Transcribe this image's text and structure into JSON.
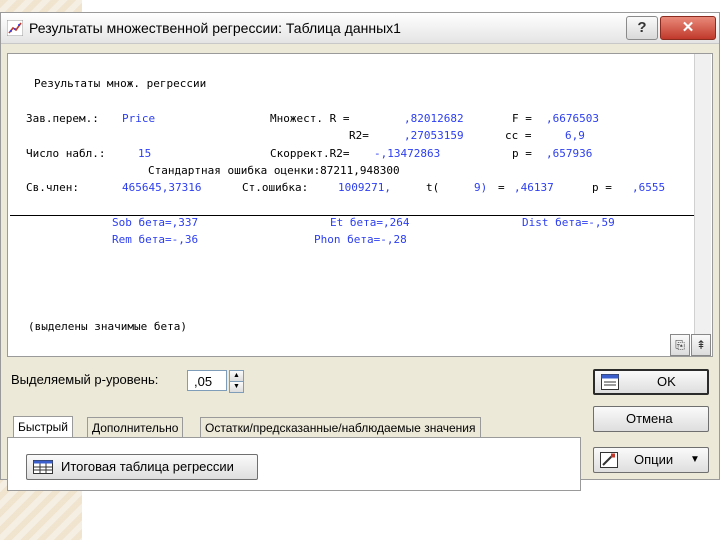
{
  "window": {
    "title": "Результаты множественной регрессии: Таблица данных1",
    "help_label": "?",
    "close_label": "✕"
  },
  "output": {
    "header": "Результаты множ. регрессии",
    "dep_var_label": "Зав.перем.:",
    "dep_var_value": "Price",
    "mult_r_label": "Множест. R =",
    "mult_r_value": ",82012682",
    "f_label": "F =",
    "f_value": ",6676503",
    "r2_label": "R2=",
    "r2_value": ",27053159",
    "cc_label": "сс =",
    "cc_value": "6,9",
    "n_label": "Число набл.:",
    "n_value": "15",
    "adj_r2_label": "Скоррект.R2=",
    "adj_r2_value": "-,13472863",
    "p_label": "p =",
    "p_value": ",657936",
    "se_estimate": "Стандартная ошибка оценки:87211,948300",
    "intercept_label": "Св.член:",
    "intercept_value": "465645,37316",
    "se_label": "Ст.ошибка:",
    "se_value": "1009271,",
    "t_label": "t(",
    "t_df": "9)",
    "t_eq": "=",
    "t_value": ",46137",
    "p2_label": "p =",
    "p2_value": ",6555",
    "beta_sob": "Sob бета=,337",
    "beta_et": "Et бета=,264",
    "beta_dist": "Dist бета=-,59",
    "beta_rem": "Rem бета=-,36",
    "beta_phon": "Phon бета=-,28",
    "footnote": "(выделены значимые бета)"
  },
  "controls": {
    "p_level_label": "Выделяемый р-уровень:",
    "p_level_value": ",05",
    "tabs": [
      "Быстрый",
      "Дополнительно",
      "Остатки/предсказанные/наблюдаемые значения"
    ],
    "summary_button": "Итоговая таблица регрессии",
    "ok_button": "OK",
    "cancel_button": "Отмена",
    "options_button": "Опции",
    "options_arrow": "▼",
    "spin_up": "▲",
    "spin_down": "▼",
    "copy_icon_glyph": "⎘",
    "pin_icon_glyph": "⇞"
  }
}
